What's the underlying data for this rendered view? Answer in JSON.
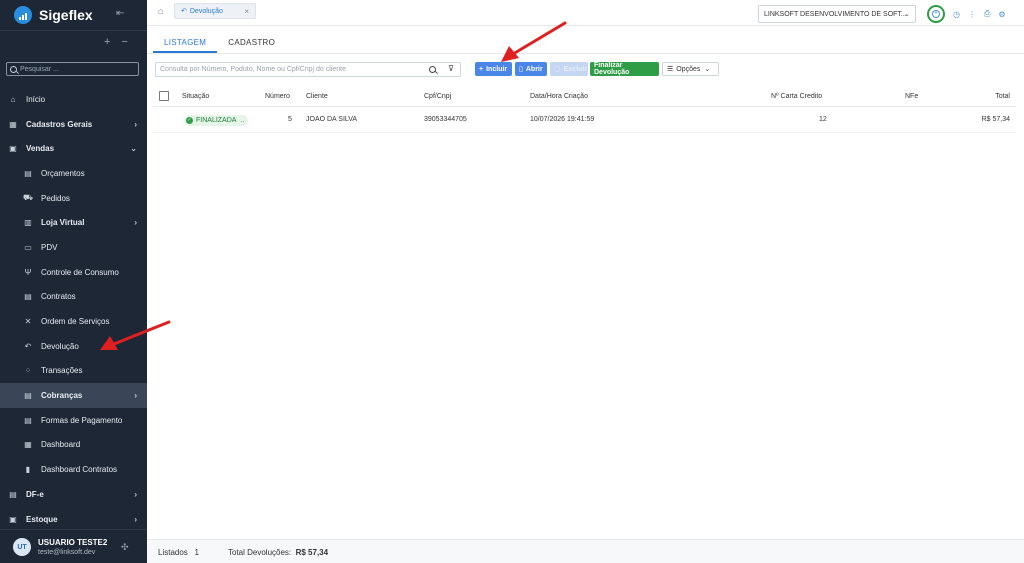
{
  "app": {
    "name": "Sigeflex"
  },
  "sidebar": {
    "search_placeholder": "Pesquisar ...",
    "items": [
      {
        "label": "Início",
        "icon": "home-icon",
        "level": 1,
        "bold": false,
        "chevron": ""
      },
      {
        "label": "Cadastros Gerais",
        "icon": "grid-icon",
        "level": 1,
        "bold": true,
        "chevron": "›"
      },
      {
        "label": "Vendas",
        "icon": "bag-icon",
        "level": 1,
        "bold": true,
        "chevron": "⌄"
      },
      {
        "label": "Orçamentos",
        "icon": "calculator-icon",
        "level": 2,
        "chevron": ""
      },
      {
        "label": "Pedidos",
        "icon": "cart-icon",
        "level": 2,
        "chevron": ""
      },
      {
        "label": "Loja Virtual",
        "icon": "store-icon",
        "level": 2,
        "bold": true,
        "chevron": "›"
      },
      {
        "label": "PDV",
        "icon": "monitor-icon",
        "level": 2,
        "chevron": ""
      },
      {
        "label": "Controle de Consumo",
        "icon": "cutlery-icon",
        "level": 2,
        "chevron": ""
      },
      {
        "label": "Contratos",
        "icon": "document-icon",
        "level": 2,
        "chevron": ""
      },
      {
        "label": "Ordem de Serviços",
        "icon": "tools-icon",
        "level": 2,
        "chevron": ""
      },
      {
        "label": "Devolução",
        "icon": "return-icon",
        "level": 2,
        "chevron": ""
      },
      {
        "label": "Transações",
        "icon": "transactions-icon",
        "level": 2,
        "chevron": ""
      },
      {
        "label": "Cobranças",
        "icon": "billing-icon",
        "level": 2,
        "bold": true,
        "chevron": "›",
        "active": true
      },
      {
        "label": "Formas de Pagamento",
        "icon": "payment-icon",
        "level": 2,
        "chevron": ""
      },
      {
        "label": "Dashboard",
        "icon": "dashboard-icon",
        "level": 2,
        "chevron": ""
      },
      {
        "label": "Dashboard Contratos",
        "icon": "bar-chart-icon",
        "level": 2,
        "chevron": ""
      },
      {
        "label": "DF-e",
        "icon": "dfe-icon",
        "level": 1,
        "bold": true,
        "chevron": "›"
      },
      {
        "label": "Estoque",
        "icon": "box-icon",
        "level": 1,
        "bold": true,
        "chevron": "›"
      }
    ],
    "user": {
      "initials": "UT",
      "name": "USUARIO TESTE2",
      "email": "teste@linksoft.dev"
    }
  },
  "topbar": {
    "tab_label": "Devolução",
    "company": "LINKSOFT DESENVOLVIMENTO DE SOFT..."
  },
  "tabs": [
    "LISTAGEM",
    "CADASTRO"
  ],
  "toolbar": {
    "search_placeholder": "Consulta por Número, Poduto, Nome ou Cpf/Cnpj do cliente.",
    "incluir": "Incluir",
    "abrir": "Abrir",
    "excluir": "Excluir",
    "finalizar": "Finalizar Devolução",
    "opcoes": "Opções"
  },
  "table": {
    "headers": {
      "situacao": "Situação",
      "numero": "Número",
      "cliente": "Cliente",
      "cpf": "Cpf/Cnpj",
      "data": "Data/Hora Criação",
      "carta": "Nº Carta Credito",
      "nfe": "NFe",
      "total": "Total"
    },
    "rows": [
      {
        "situacao": "FINALIZADA",
        "numero": "5",
        "cliente": "JOAO DA SILVA",
        "cpf": "39053344705",
        "data": "10/07/2026 19:41:59",
        "carta": "12",
        "nfe": "",
        "total": "R$ 57,34"
      }
    ]
  },
  "footer": {
    "listados_label": "Listados",
    "listados_value": "1",
    "total_label": "Total Devoluções:",
    "total_value": "R$ 57,34"
  },
  "colors": {
    "sidebar": "#1d2735",
    "accent": "#2a7ad2",
    "success": "#2e9d46",
    "annotation": "#e02020"
  }
}
